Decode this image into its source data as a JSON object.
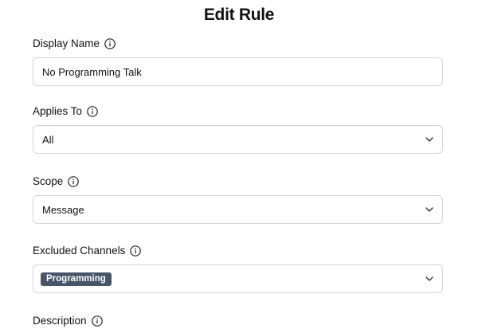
{
  "page": {
    "title": "Edit Rule"
  },
  "fields": {
    "display_name": {
      "label": "Display Name",
      "value": "No Programming Talk"
    },
    "applies_to": {
      "label": "Applies To",
      "value": "All"
    },
    "scope": {
      "label": "Scope",
      "value": "Message"
    },
    "excluded_channels": {
      "label": "Excluded Channels",
      "chips": [
        "Programming"
      ]
    },
    "description": {
      "label": "Description"
    }
  },
  "icons": {
    "info": "info-circle-icon",
    "dropdown": "chevron-down-icon"
  },
  "colors": {
    "text": "#111111",
    "border": "#d4d4d4",
    "chip_bg": "#475569",
    "chip_text": "#ffffff"
  }
}
